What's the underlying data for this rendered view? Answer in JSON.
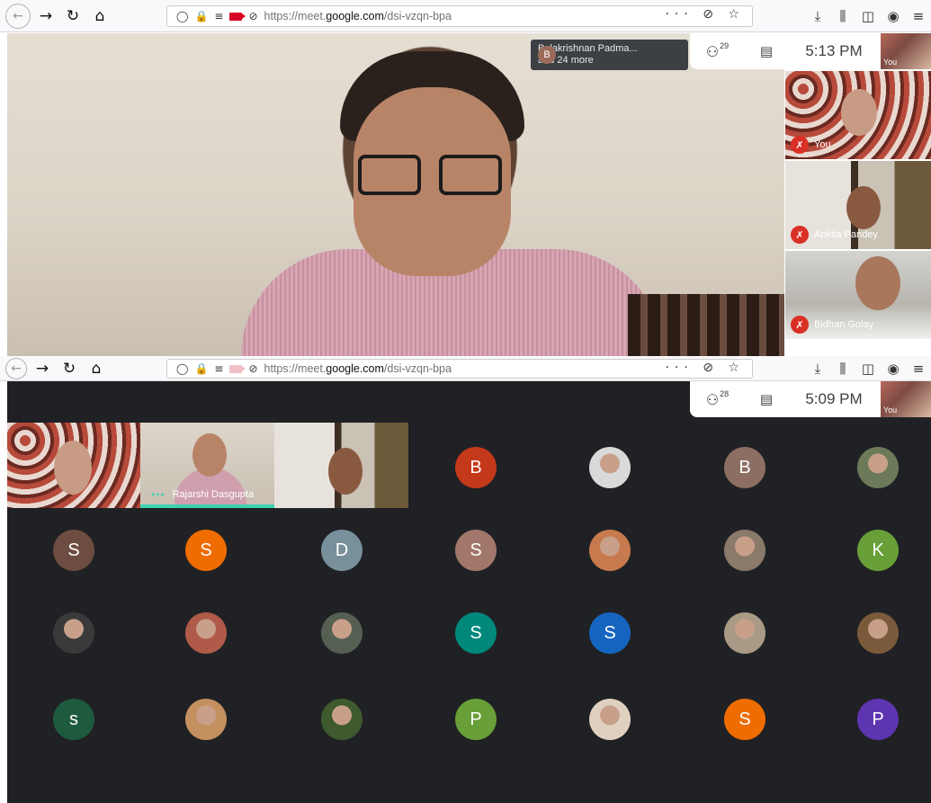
{
  "top": {
    "url_prefix": "https://meet.",
    "url_domain": "google.com",
    "url_path": "/dsi-vzqn-bpa",
    "page_actions": "··· ⊘ ☆",
    "toolbar_right": [
      "⤓",
      "⫼",
      "◫",
      "◉",
      "≡"
    ],
    "notification": {
      "initial": "B",
      "line1": "Balakrishnan Padma...",
      "line2": "and 24 more"
    },
    "participant_count": "29",
    "time": "5:13 PM",
    "self_label": "You",
    "side_tiles": [
      {
        "name": "You"
      },
      {
        "name": "Ankita Pandey"
      },
      {
        "name": "Bidhan Golay"
      }
    ]
  },
  "bottom": {
    "url_prefix": "https://meet.",
    "url_domain": "google.com",
    "url_path": "/dsi-vzqn-bpa",
    "page_actions": "··· ⊘ ☆",
    "toolbar_right": [
      "⤓",
      "⫼",
      "◫",
      "◉",
      "≡"
    ],
    "participant_count": "28",
    "time": "5:09 PM",
    "self_label": "You",
    "speaker_name": "Rajarshi Dasgupta",
    "avatars": [
      {
        "letter": "B",
        "color": "#c5391b"
      },
      {
        "letter": "",
        "color": "#d9d9d9",
        "photo": true
      },
      {
        "letter": "B",
        "color": "#8d6e63"
      },
      {
        "letter": "",
        "color": "#6c7a5a",
        "photo": true
      },
      {
        "letter": "S",
        "color": "#6d4c41"
      },
      {
        "letter": "S",
        "color": "#ef6c00"
      },
      {
        "letter": "D",
        "color": "#78909c"
      },
      {
        "letter": "S",
        "color": "#a1776b"
      },
      {
        "letter": "",
        "color": "#c77a4d",
        "photo": true
      },
      {
        "letter": "",
        "color": "#8a7a6a",
        "photo": true
      },
      {
        "letter": "K",
        "color": "#689f38"
      },
      {
        "letter": "",
        "color": "#3a3a3a",
        "photo": true
      },
      {
        "letter": "",
        "color": "#b05a4a",
        "photo": true
      },
      {
        "letter": "",
        "color": "#555f52",
        "photo": true
      },
      {
        "letter": "S",
        "color": "#00897b"
      },
      {
        "letter": "S",
        "color": "#1565c0"
      },
      {
        "letter": "",
        "color": "#a89a84",
        "photo": true
      },
      {
        "letter": "",
        "color": "#7a5a3a",
        "photo": true
      },
      {
        "letter": "s",
        "color": "#1e5a3e"
      },
      {
        "letter": "",
        "color": "#c49060",
        "photo": true
      },
      {
        "letter": "",
        "color": "#3e5a2e",
        "photo": true
      },
      {
        "letter": "P",
        "color": "#689f38"
      },
      {
        "letter": "",
        "color": "#e0d0c0",
        "photo": true
      },
      {
        "letter": "S",
        "color": "#ef6c00"
      },
      {
        "letter": "P",
        "color": "#5e35b1"
      }
    ]
  }
}
